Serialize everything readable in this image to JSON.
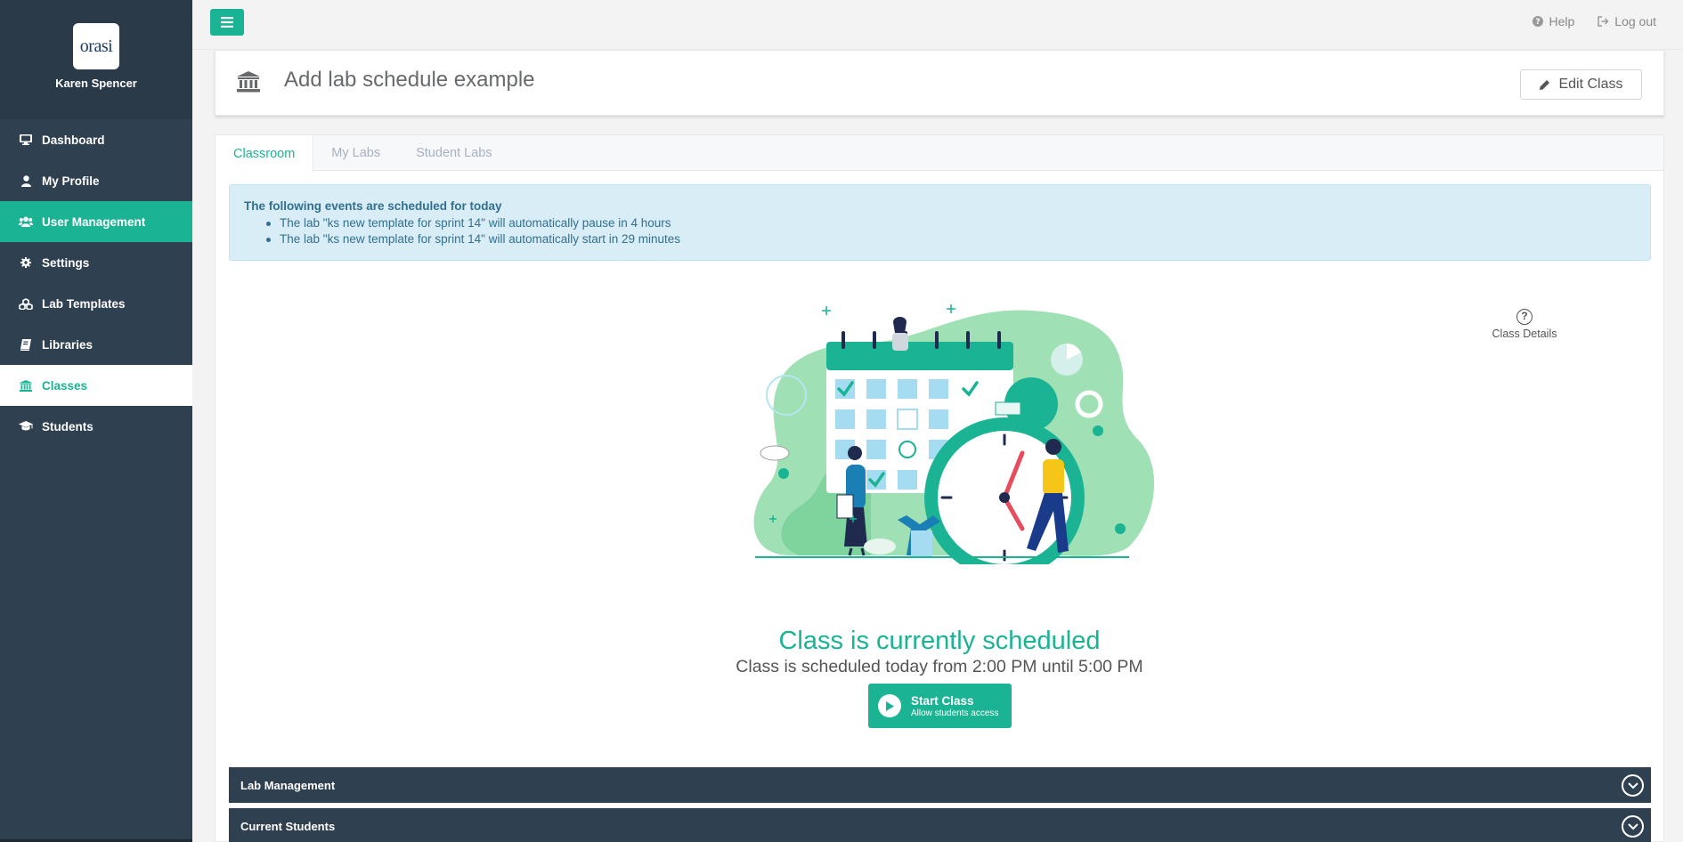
{
  "sidebar": {
    "logo_text": "orasi",
    "user_name": "Karen Spencer",
    "items": [
      {
        "label": "Dashboard",
        "icon": "desktop-icon"
      },
      {
        "label": "My Profile",
        "icon": "user-icon"
      },
      {
        "label": "User Management",
        "icon": "users-icon"
      },
      {
        "label": "Settings",
        "icon": "gear-icon"
      },
      {
        "label": "Lab Templates",
        "icon": "cubes-icon"
      },
      {
        "label": "Libraries",
        "icon": "book-icon"
      },
      {
        "label": "Classes",
        "icon": "institution-icon"
      },
      {
        "label": "Students",
        "icon": "graduation-cap-icon"
      }
    ]
  },
  "topbar": {
    "help_label": "Help",
    "logout_label": "Log out"
  },
  "header": {
    "title": "Add lab schedule example",
    "edit_label": "Edit Class"
  },
  "tabs": [
    "Classroom",
    "My Labs",
    "Student Labs"
  ],
  "alert": {
    "title": "The following events are scheduled for today",
    "items": [
      "The lab \"ks new template for sprint 14\" will automatically pause in 4 hours",
      "The lab \"ks new template for sprint 14\" will automatically start in 29 minutes"
    ]
  },
  "class_details_label": "Class Details",
  "status": {
    "title": "Class is currently scheduled",
    "subtitle": "Class is scheduled today from 2:00 PM until 5:00 PM"
  },
  "start_button": {
    "label": "Start Class",
    "sublabel": "Allow students access"
  },
  "sections": [
    "Lab Management",
    "Current Students"
  ],
  "colors": {
    "sidebar": "#2f4050",
    "accent": "#1ab394",
    "alert_bg": "#d9edf7"
  }
}
